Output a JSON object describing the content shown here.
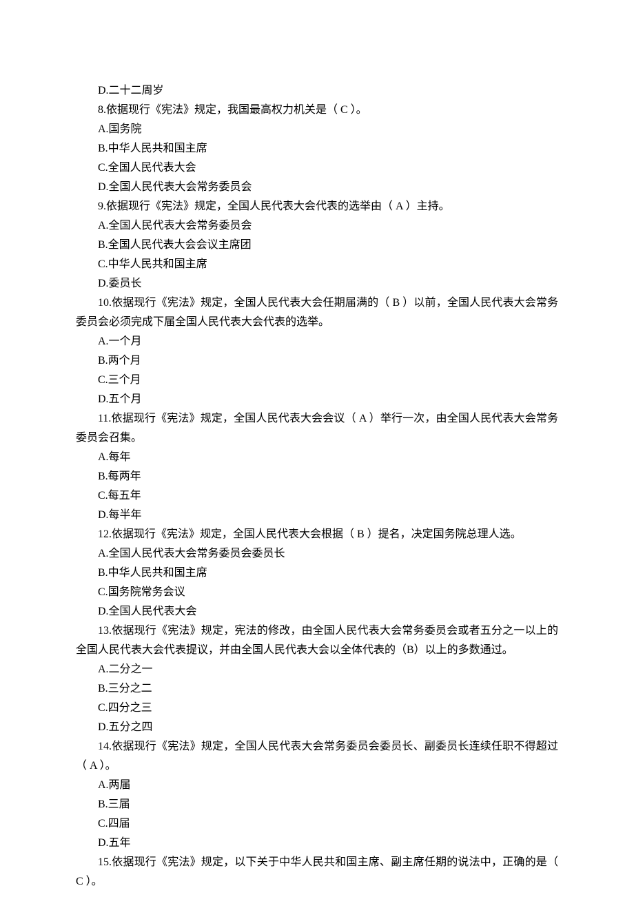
{
  "lines": [
    {
      "class": "option",
      "text": "D.二十二周岁"
    },
    {
      "class": "question",
      "text": "8.依据现行《宪法》规定，我国最高权力机关是（ C ）。"
    },
    {
      "class": "option",
      "text": "A.国务院"
    },
    {
      "class": "option",
      "text": "B.中华人民共和国主席"
    },
    {
      "class": "option",
      "text": "C.全国人民代表大会"
    },
    {
      "class": "option",
      "text": "D.全国人民代表大会常务委员会"
    },
    {
      "class": "question",
      "text": "9.依据现行《宪法》规定，全国人民代表大会代表的选举由（ A ）主持。"
    },
    {
      "class": "option",
      "text": "A.全国人民代表大会常务委员会"
    },
    {
      "class": "option",
      "text": "B.全国人民代表大会会议主席团"
    },
    {
      "class": "option",
      "text": "C.中华人民共和国主席"
    },
    {
      "class": "option",
      "text": "D.委员长"
    },
    {
      "class": "question",
      "text": "10.依据现行《宪法》规定，全国人民代表大会任期届满的（ B ）以前，全国人民代表大会常务委员会必须完成下届全国人民代表大会代表的选举。"
    },
    {
      "class": "option",
      "text": "A.一个月"
    },
    {
      "class": "option",
      "text": "B.两个月"
    },
    {
      "class": "option",
      "text": "C.三个月"
    },
    {
      "class": "option",
      "text": "D.五个月"
    },
    {
      "class": "question",
      "text": "11.依据现行《宪法》规定，全国人民代表大会会议（ A ）举行一次，由全国人民代表大会常务委员会召集。"
    },
    {
      "class": "option",
      "text": "A.每年"
    },
    {
      "class": "option",
      "text": "B.每两年"
    },
    {
      "class": "option",
      "text": "C.每五年"
    },
    {
      "class": "option",
      "text": "D.每半年"
    },
    {
      "class": "question",
      "text": "12.依据现行《宪法》规定，全国人民代表大会根据（ B ）提名，决定国务院总理人选。"
    },
    {
      "class": "option",
      "text": "A.全国人民代表大会常务委员会委员长"
    },
    {
      "class": "option",
      "text": "B.中华人民共和国主席"
    },
    {
      "class": "option",
      "text": "C.国务院常务会议"
    },
    {
      "class": "option",
      "text": "D.全国人民代表大会"
    },
    {
      "class": "question",
      "text": "13.依据现行《宪法》规定，宪法的修改，由全国人民代表大会常务委员会或者五分之一以上的全国人民代表大会代表提议，并由全国人民代表大会以全体代表的（B）以上的多数通过。"
    },
    {
      "class": "option",
      "text": "A.二分之一"
    },
    {
      "class": "option",
      "text": "B.三分之二"
    },
    {
      "class": "option",
      "text": "C.四分之三"
    },
    {
      "class": "option",
      "text": "D.五分之四"
    },
    {
      "class": "question",
      "text": "14.依据现行《宪法》规定，全国人民代表大会常务委员会委员长、副委员长连续任职不得超过（ A ）。"
    },
    {
      "class": "option",
      "text": "A.两届"
    },
    {
      "class": "option",
      "text": "B.三届"
    },
    {
      "class": "option",
      "text": "C.四届"
    },
    {
      "class": "option",
      "text": "D.五年"
    },
    {
      "class": "question",
      "text": "15.依据现行《宪法》规定，以下关于中华人民共和国主席、副主席任期的说法中，正确的是（ C ）。"
    }
  ]
}
